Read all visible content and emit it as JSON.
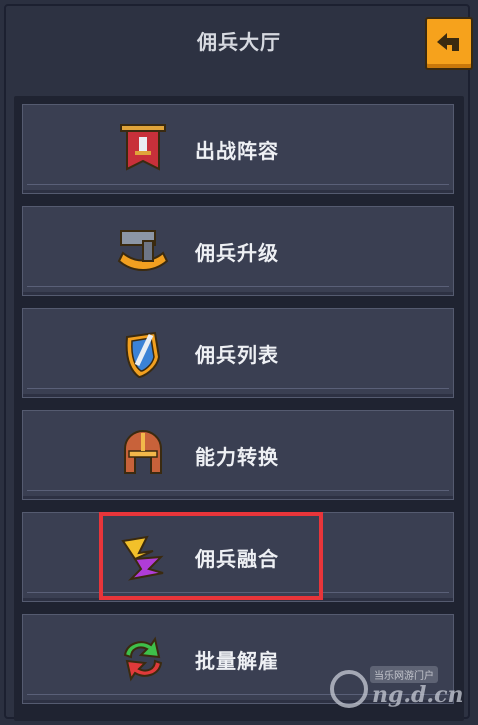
{
  "header": {
    "title": "佣兵大厅",
    "back_icon": "back-arrow-icon",
    "accent": "#f6a21c"
  },
  "menu": {
    "items": [
      {
        "label": "出战阵容",
        "icon": "banner-icon"
      },
      {
        "label": "佣兵升级",
        "icon": "hammer-icon"
      },
      {
        "label": "佣兵列表",
        "icon": "sword-shield-icon"
      },
      {
        "label": "能力转换",
        "icon": "helmet-icon"
      },
      {
        "label": "佣兵融合",
        "icon": "fusion-icon"
      },
      {
        "label": "批量解雇",
        "icon": "recycle-icon"
      }
    ]
  },
  "highlight_color": "#e8353a",
  "watermark": {
    "small": "当乐网游门户",
    "big": "ng.d.cn"
  }
}
